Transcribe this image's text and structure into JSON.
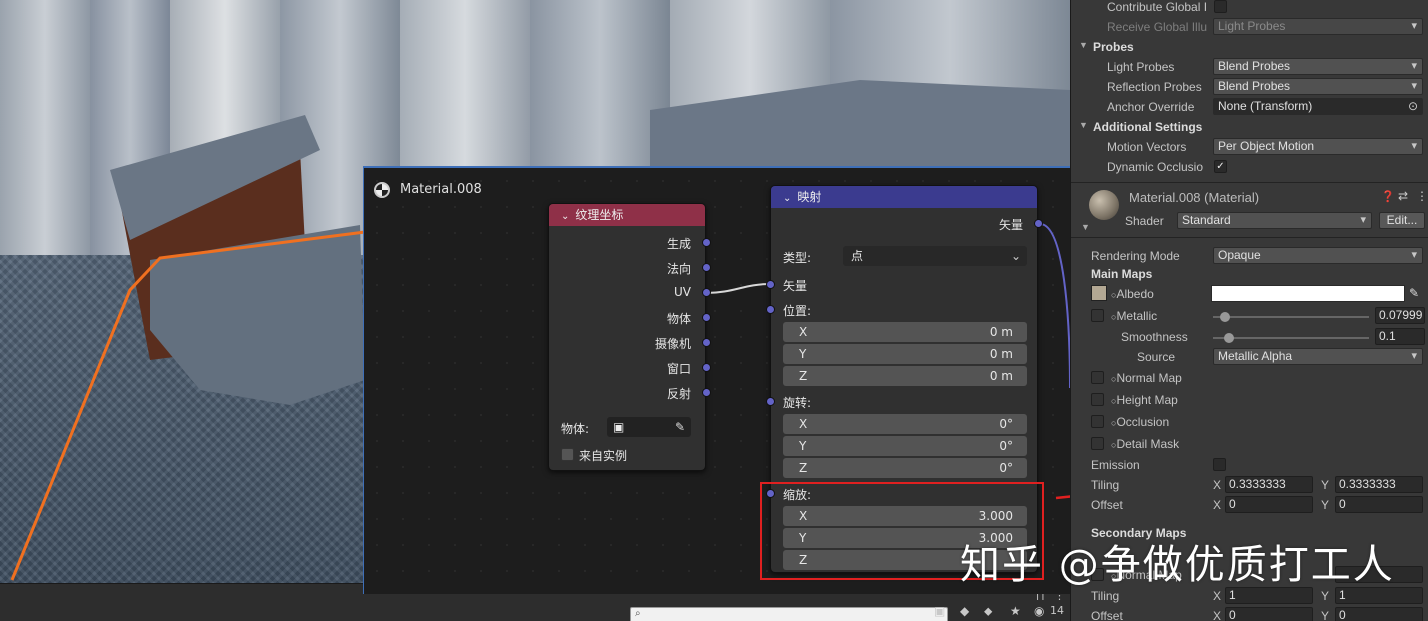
{
  "node_editor": {
    "material_name": "Material.008",
    "texcoord_node": {
      "title": "纹理坐标",
      "outputs": [
        "生成",
        "法向",
        "UV",
        "物体",
        "摄像机",
        "窗口",
        "反射"
      ],
      "object_label": "物体:",
      "from_instancer_label": "来自实例"
    },
    "mapping_node": {
      "title": "映射",
      "output_vector": "矢量",
      "type_label": "类型:",
      "type_value": "点",
      "input_vector": "矢量",
      "location_label": "位置:",
      "location": [
        {
          "axis": "X",
          "value": "0 m"
        },
        {
          "axis": "Y",
          "value": "0 m"
        },
        {
          "axis": "Z",
          "value": "0 m"
        }
      ],
      "rotation_label": "旋转:",
      "rotation": [
        {
          "axis": "X",
          "value": "0°"
        },
        {
          "axis": "Y",
          "value": "0°"
        },
        {
          "axis": "Z",
          "value": "0°"
        }
      ],
      "scale_label": "缩放:",
      "scale": [
        {
          "axis": "X",
          "value": "3.000"
        },
        {
          "axis": "Y",
          "value": "3.000"
        },
        {
          "axis": "Z",
          "value": ""
        }
      ]
    }
  },
  "inspector": {
    "contribute_gi_label": "Contribute Global I",
    "receive_gi_label": "Receive Global Illu",
    "receive_gi_value": "Light Probes",
    "probes_section": "Probes",
    "light_probes_label": "Light Probes",
    "light_probes_value": "Blend Probes",
    "reflection_probes_label": "Reflection Probes",
    "reflection_probes_value": "Blend Probes",
    "anchor_override_label": "Anchor Override",
    "anchor_override_value": "None (Transform)",
    "additional_section": "Additional Settings",
    "motion_vectors_label": "Motion Vectors",
    "motion_vectors_value": "Per Object Motion",
    "dynamic_occlusion_label": "Dynamic Occlusio",
    "material_title": "Material.008 (Material)",
    "shader_label": "Shader",
    "shader_value": "Standard",
    "edit_button": "Edit...",
    "rendering_mode_label": "Rendering Mode",
    "rendering_mode_value": "Opaque",
    "main_maps_section": "Main Maps",
    "albedo_label": "Albedo",
    "metallic_label": "Metallic",
    "metallic_value": "0.07999",
    "metallic_level": 0.08,
    "smoothness_label": "Smoothness",
    "smoothness_value": "0.1",
    "smoothness_level": 0.1,
    "source_label": "Source",
    "source_value": "Metallic Alpha",
    "normal_map_label": "Normal Map",
    "height_map_label": "Height Map",
    "occlusion_label": "Occlusion",
    "detail_mask_label": "Detail Mask",
    "emission_label": "Emission",
    "tiling_label": "Tiling",
    "tiling_x": "0.3333333",
    "tiling_y": "0.3333333",
    "offset_label": "Offset",
    "offset_x": "0",
    "offset_y": "0",
    "secondary_maps_section": "Secondary Maps",
    "secondary_normal_label": "Normal Map",
    "secondary_tiling_label": "Tiling",
    "secondary_tiling_x": "1",
    "secondary_tiling_y": "1",
    "secondary_offset_label": "Offset",
    "secondary_offset_x": "0",
    "secondary_offset_y": "0",
    "x_axis": "X",
    "y_axis": "Y"
  },
  "scene": {
    "hidden_count": "14"
  },
  "watermark": "知乎 @争做优质打工人",
  "colors": {
    "texcoord_header": "#8f3048",
    "mapping_header": "#3b3b8f",
    "socket": "#6363c7",
    "highlight": "#e02020",
    "selection": "#f07020"
  }
}
